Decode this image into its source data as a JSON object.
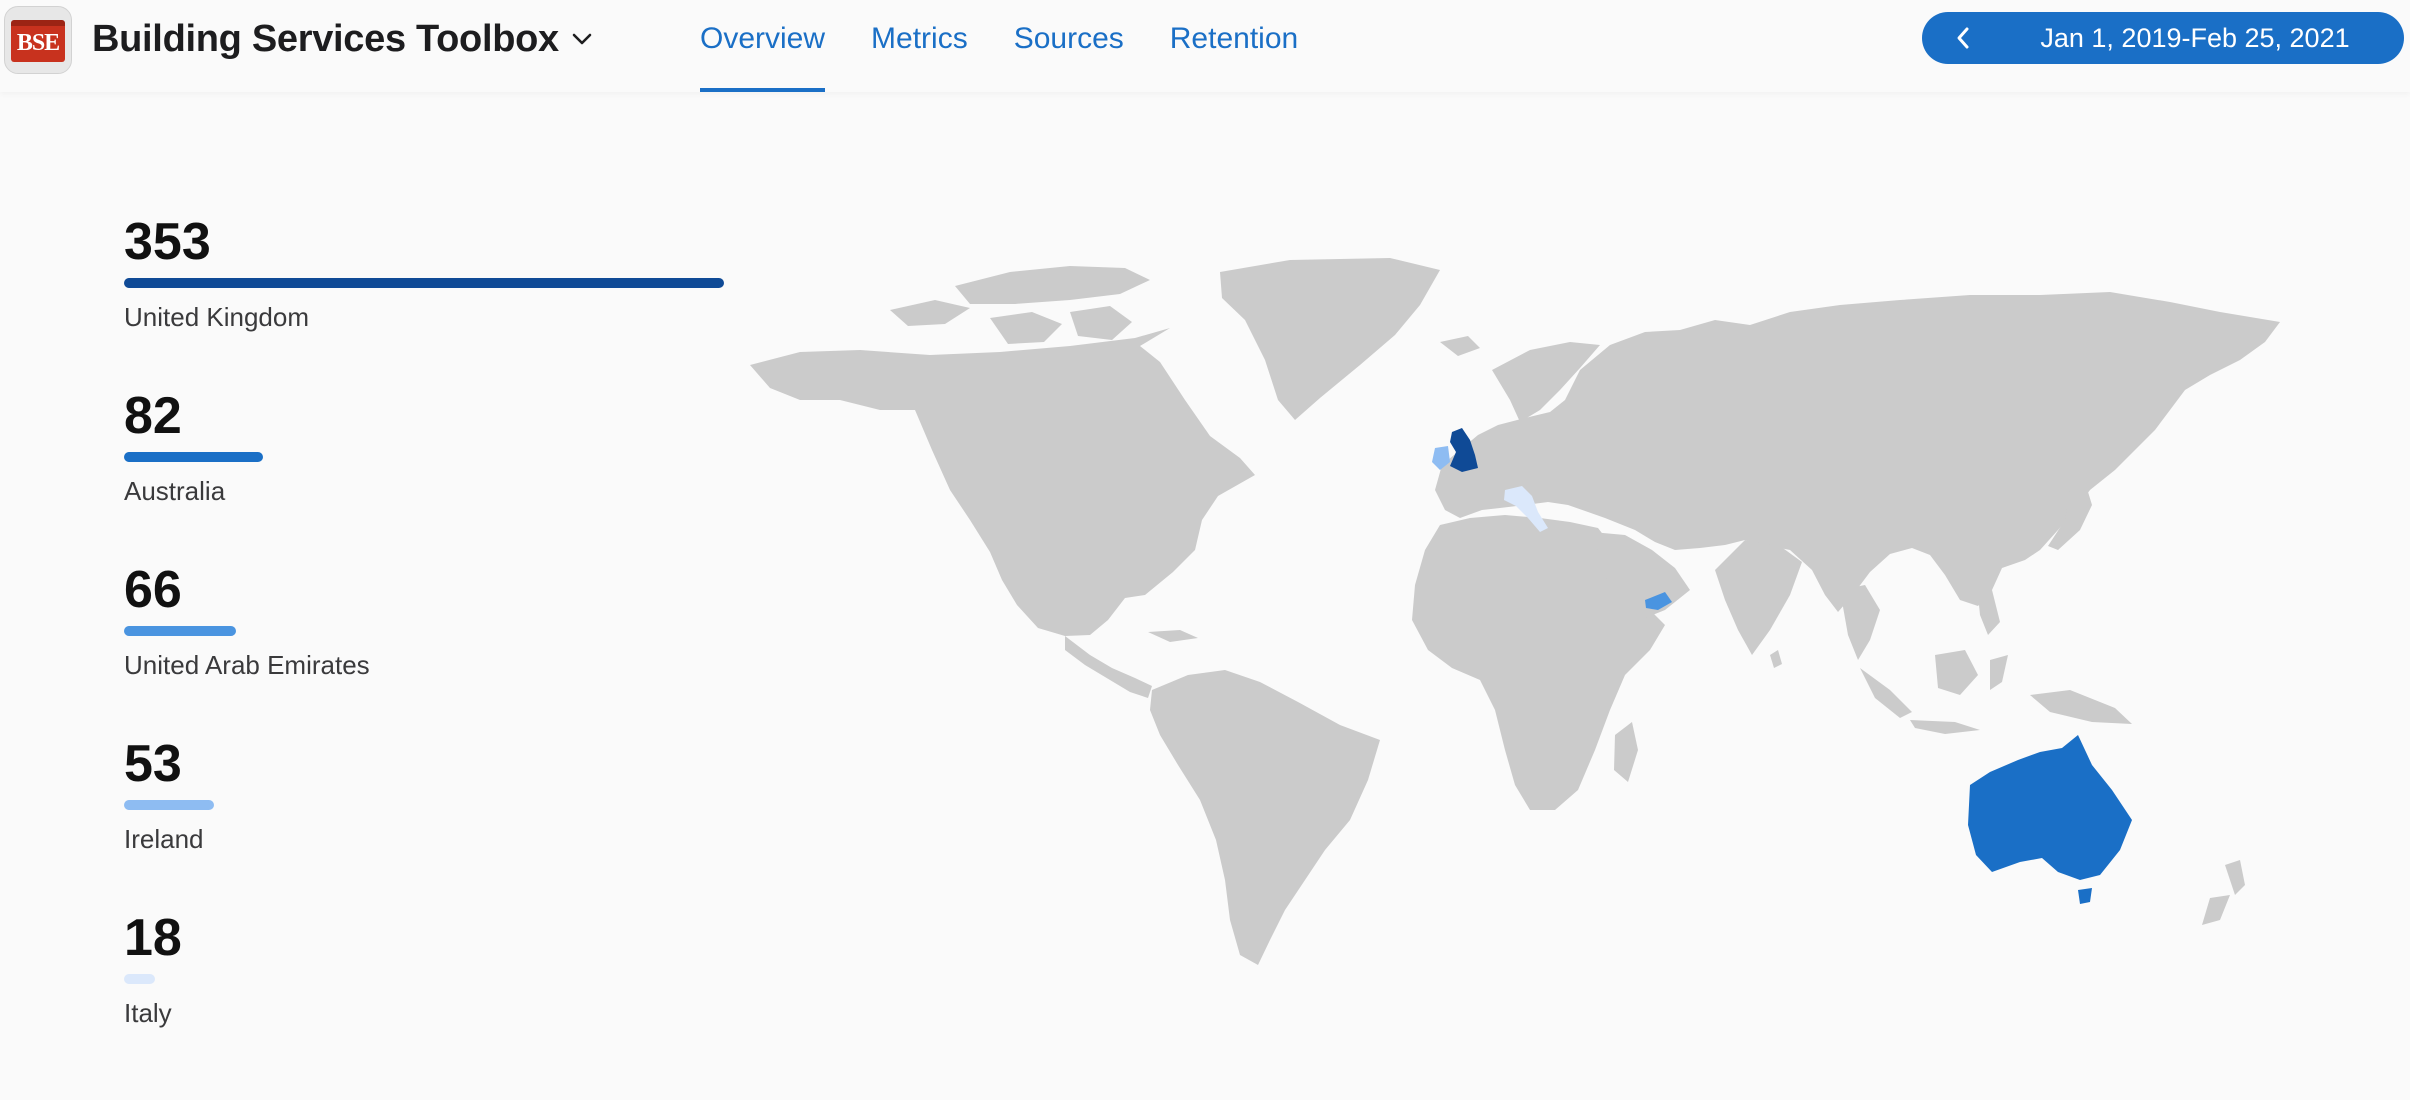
{
  "header": {
    "app_title": "Building Services Toolbox",
    "app_icon_text": "BSE",
    "nav_tabs": [
      {
        "label": "Overview",
        "active": true
      },
      {
        "label": "Metrics",
        "active": false
      },
      {
        "label": "Sources",
        "active": false
      },
      {
        "label": "Retention",
        "active": false
      }
    ],
    "date_range": "Jan 1, 2019-Feb 25, 2021"
  },
  "countries": [
    {
      "name": "United Kingdom",
      "value": 353,
      "color": "#0f4a96"
    },
    {
      "name": "Australia",
      "value": 82,
      "color": "#1a6fc6"
    },
    {
      "name": "United Arab Emirates",
      "value": 66,
      "color": "#4a94e0"
    },
    {
      "name": "Ireland",
      "value": 53,
      "color": "#8ebcf2"
    },
    {
      "name": "Italy",
      "value": 18,
      "color": "#dbe8fb"
    }
  ],
  "map": {
    "land_color": "#cbcbcb",
    "highlighted": [
      {
        "country": "United Kingdom",
        "color": "#0f4a96"
      },
      {
        "country": "Australia",
        "color": "#1a6fc6"
      },
      {
        "country": "United Arab Emirates",
        "color": "#4a94e0"
      },
      {
        "country": "Ireland",
        "color": "#8ebcf2"
      },
      {
        "country": "Italy",
        "color": "#dbe8fb"
      }
    ]
  }
}
